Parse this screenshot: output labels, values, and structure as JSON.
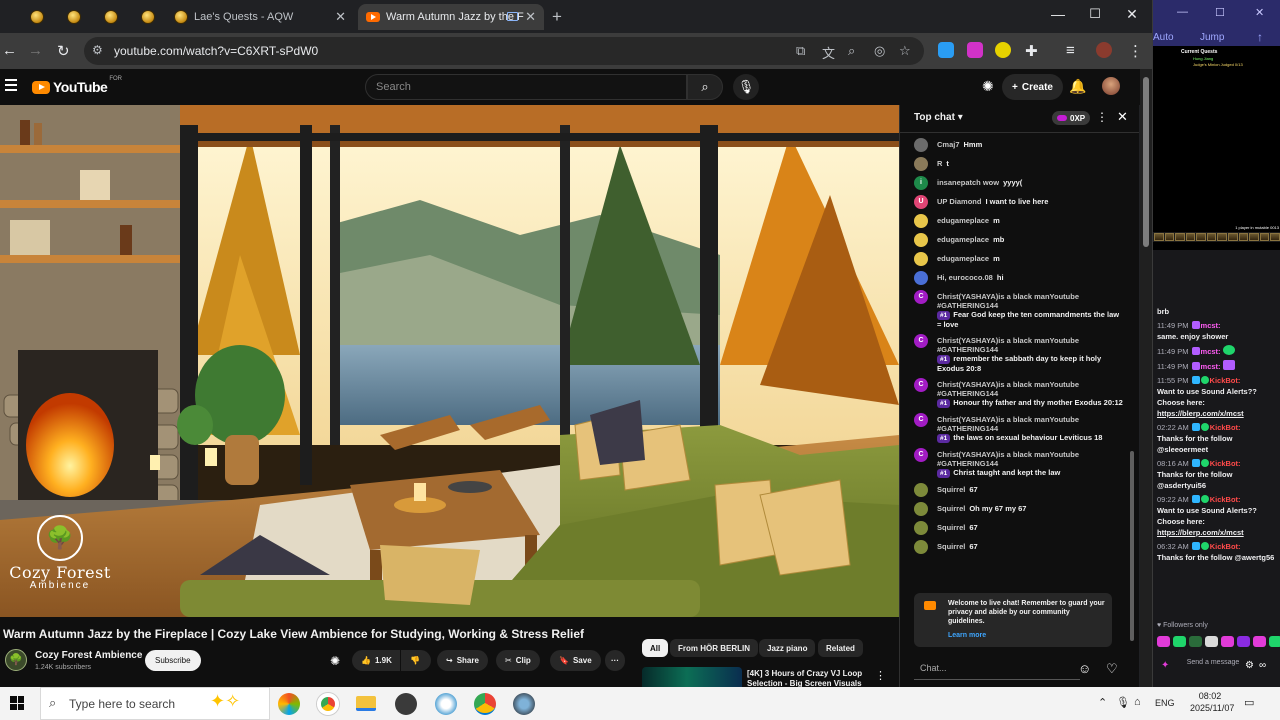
{
  "browser": {
    "pinned_tabs": 4,
    "tabs": [
      {
        "title": "Lae's Quests - AQW",
        "active": false
      },
      {
        "title": "Warm Autumn Jazz by the F",
        "active": true
      }
    ],
    "url": "youtube.com/watch?v=C6XRT-sPdW0",
    "window_controls": {
      "minimize": "—",
      "maximize": "☐",
      "close": "✕"
    }
  },
  "youtube": {
    "logo_text": "YouTube",
    "logo_superscript": "FOR",
    "search_placeholder": "Search",
    "create_label": "Create"
  },
  "video": {
    "watermark_line1": "Cozy Forest",
    "watermark_line2": "Ambience",
    "title": "Warm Autumn Jazz by the Fireplace | Cozy Lake View Ambience for Studying, Working & Stress Relief",
    "channel": "Cozy Forest Ambience",
    "subscribers": "1.24K subscribers",
    "subscribe_label": "Subscribe",
    "likes": "1.9K",
    "share_label": "Share",
    "clip_label": "Clip",
    "save_label": "Save",
    "more_label": "···"
  },
  "recommendations": {
    "chips": [
      "All",
      "From HÖR BERLIN",
      "Jazz piano",
      "Related"
    ],
    "first_title": "[4K] 3 Hours of Crazy VJ Loop Selection - Big Screen Visuals"
  },
  "live_chat": {
    "header": "Top chat",
    "xp": "0XP",
    "messages": [
      {
        "author": "Cmaj7",
        "text": "Hmm",
        "avatar_color": "#6b6b6b",
        "avatar_letter": ""
      },
      {
        "author": "R",
        "text": "t",
        "avatar_color": "#8a7a5a",
        "avatar_letter": ""
      },
      {
        "author": "insanepatch wow",
        "text": "yyyy(",
        "avatar_color": "#1e8a4a",
        "avatar_letter": "i"
      },
      {
        "author": "UP Diamond",
        "text": "I want to live here",
        "avatar_color": "#e04575",
        "avatar_letter": "U"
      },
      {
        "author": "edugameplace",
        "text": "m",
        "avatar_color": "#e8c64a",
        "avatar_letter": ""
      },
      {
        "author": "edugameplace",
        "text": "mb",
        "avatar_color": "#e8c64a",
        "avatar_letter": ""
      },
      {
        "author": "edugameplace",
        "text": "m",
        "avatar_color": "#e8c64a",
        "avatar_letter": ""
      },
      {
        "author": "Hi, eurococo.08",
        "text": "hi",
        "avatar_color": "#4a6fd6",
        "avatar_letter": ""
      },
      {
        "author": "Christ(YASHAYA)is a black manYoutube #GATHERING144",
        "tag": "#1",
        "text": "Fear God keep the ten commandments the law = love",
        "avatar_color": "#a21cc4",
        "avatar_letter": "C"
      },
      {
        "author": "Christ(YASHAYA)is a black manYoutube #GATHERING144",
        "tag": "#1",
        "text": "remember the sabbath day to keep it holy Exodus 20:8",
        "avatar_color": "#a21cc4",
        "avatar_letter": "C"
      },
      {
        "author": "Christ(YASHAYA)is a black manYoutube #GATHERING144",
        "tag": "#1",
        "text": "Honour thy father and thy mother Exodus 20:12",
        "avatar_color": "#a21cc4",
        "avatar_letter": "C"
      },
      {
        "author": "Christ(YASHAYA)is a black manYoutube #GATHERING144",
        "tag": "#1",
        "text": "the laws on sexual behaviour Leviticus 18",
        "avatar_color": "#a21cc4",
        "avatar_letter": "C"
      },
      {
        "author": "Christ(YASHAYA)is a black manYoutube #GATHERING144",
        "tag": "#1",
        "text": "Christ taught and kept the law",
        "avatar_color": "#a21cc4",
        "avatar_letter": "C"
      },
      {
        "author": "Squirrel",
        "text": "67",
        "avatar_color": "#7d8a3a",
        "avatar_letter": ""
      },
      {
        "author": "Squirrel",
        "text": "Oh my 67 my 67",
        "avatar_color": "#7d8a3a",
        "avatar_letter": ""
      },
      {
        "author": "Squirrel",
        "text": "67",
        "avatar_color": "#7d8a3a",
        "avatar_letter": ""
      },
      {
        "author": "Squirrel",
        "text": "67",
        "avatar_color": "#7d8a3a",
        "avatar_letter": ""
      }
    ],
    "welcome": "Welcome to live chat! Remember to guard your privacy and abide by our community guidelines.",
    "learn_more": "Learn more",
    "input_placeholder": "Chat..."
  },
  "side_window": {
    "auto_label": "Auto",
    "jump_label": "Jump",
    "game_quest_title": "Current Quests",
    "game_quest_line1": "Hung Jiang",
    "game_quest_line2": "Judge's Minion Judged 0/13",
    "game_player_count": "1 player in mutable 0013",
    "chat": [
      {
        "type": "plain",
        "text": "brb"
      },
      {
        "type": "user",
        "time": "11:49 PM",
        "user": "mcst:",
        "text": "same. enjoy shower"
      },
      {
        "type": "user",
        "time": "11:49 PM",
        "user": "mcst:",
        "text": ""
      },
      {
        "type": "user",
        "time": "11:49 PM",
        "user": "mcst:",
        "text": ""
      },
      {
        "type": "bot",
        "time": "11:55 PM",
        "user": "KickBot:",
        "text": "Want to use Sound Alerts?? Choose here:",
        "link": "https://blerp.com/x/mcst"
      },
      {
        "type": "bot",
        "time": "02:22 AM",
        "user": "KickBot:",
        "text": "Thanks for the follow @sleeoermeet",
        "link": ""
      },
      {
        "type": "bot",
        "time": "08:16 AM",
        "user": "KickBot:",
        "text": "Thanks for the follow @asdertyui56",
        "link": ""
      },
      {
        "type": "bot",
        "time": "09:22 AM",
        "user": "KickBot:",
        "text": "Want to use Sound Alerts?? Choose here:",
        "link": "https://blerp.com/x/mcst"
      },
      {
        "type": "bot",
        "time": "06:32 AM",
        "user": "KickBot:",
        "text": "Thanks for the follow @awertg56",
        "link": ""
      }
    ],
    "followers_only": "Followers only",
    "send_message": "Send a message"
  },
  "taskbar": {
    "search_placeholder": "Type here to search",
    "language": "ENG",
    "time": "08:02",
    "date": "2025/11/07"
  }
}
